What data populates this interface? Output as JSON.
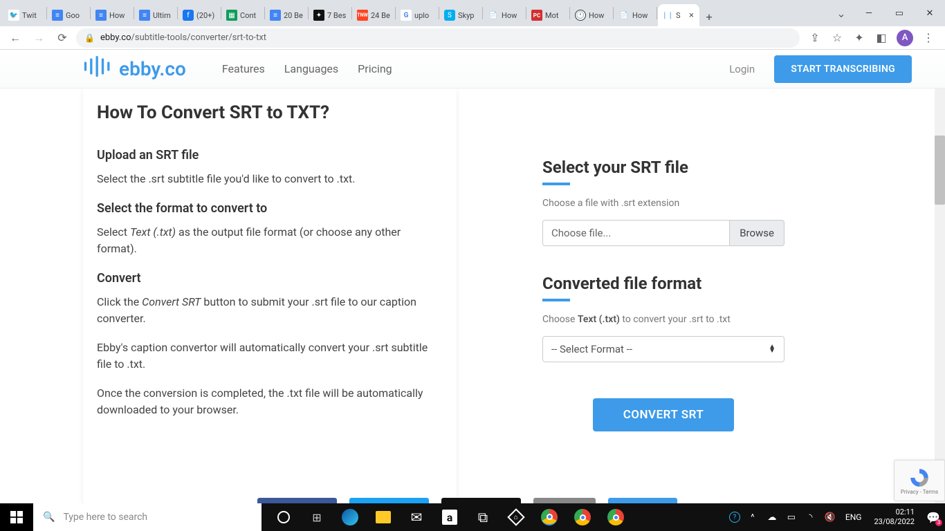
{
  "browser": {
    "tabs": [
      {
        "title": "Twit",
        "icon": "twitter",
        "cls": "fav-twitter",
        "glyph": "🐦"
      },
      {
        "title": "Goo",
        "icon": "gdocs",
        "cls": "fav-docs",
        "glyph": "≡"
      },
      {
        "title": "How",
        "icon": "gdocs",
        "cls": "fav-docs",
        "glyph": "≡"
      },
      {
        "title": "Ultim",
        "icon": "gdocs",
        "cls": "fav-docs",
        "glyph": "≡"
      },
      {
        "title": "(20+)",
        "icon": "facebook",
        "cls": "fav-fb",
        "glyph": "f"
      },
      {
        "title": "Cont",
        "icon": "gsheets",
        "cls": "fav-sheets",
        "glyph": "▦"
      },
      {
        "title": "20 Be",
        "icon": "gdocs",
        "cls": "fav-docs",
        "glyph": "≡"
      },
      {
        "title": "7 Bes",
        "icon": "black",
        "cls": "fav-black",
        "glyph": "✦"
      },
      {
        "title": "24 Be",
        "icon": "tnw",
        "cls": "fav-tnw",
        "glyph": "TNW"
      },
      {
        "title": "uplo",
        "icon": "google",
        "cls": "fav-google",
        "glyph": "G"
      },
      {
        "title": "Skyp",
        "icon": "skype",
        "cls": "fav-skype",
        "glyph": "S"
      },
      {
        "title": "How",
        "icon": "doc",
        "cls": "",
        "glyph": "📄"
      },
      {
        "title": "Mot",
        "icon": "pcmag",
        "cls": "fav-pc",
        "glyph": "PC"
      },
      {
        "title": "How",
        "icon": "clock",
        "cls": "fav-clock",
        "glyph": "🕐"
      },
      {
        "title": "How",
        "icon": "doc",
        "cls": "",
        "glyph": "📄"
      },
      {
        "title": "S",
        "icon": "ebby",
        "cls": "fav-ebby",
        "glyph": "❘❘",
        "active": true
      }
    ],
    "url_domain": "ebby.co",
    "url_path": "/subtitle-tools/converter/srt-to-txt",
    "avatar_letter": "A"
  },
  "header": {
    "logo_text": "ebby.co",
    "nav": [
      "Features",
      "Languages",
      "Pricing"
    ],
    "login": "Login",
    "cta": "START TRANSCRIBING"
  },
  "left": {
    "title": "How To Convert SRT to TXT?",
    "s1_h": "Upload an SRT file",
    "s1_p": "Select the .srt subtitle file you'd like to convert to .txt.",
    "s2_h": "Select the format to convert to",
    "s2_p_a": "Select ",
    "s2_p_em": "Text (.txt)",
    "s2_p_b": " as the output file format (or choose any other format).",
    "s3_h": "Convert",
    "s3_p1_a": "Click the ",
    "s3_p1_em": "Convert SRT",
    "s3_p1_b": " button to submit your .srt file to our caption converter.",
    "s3_p2": "Ebby's caption convertor will automatically convert your .srt subtitle file to .txt.",
    "s3_p3": "Once the conversion is completed, the .txt file will be automatically downloaded to your browser."
  },
  "right": {
    "h1": "Select your SRT file",
    "sub1": "Choose a file with .srt extension",
    "file_placeholder": "Choose file...",
    "browse": "Browse",
    "h2": "Converted file format",
    "sub2_a": "Choose ",
    "sub2_strong": "Text (.txt)",
    "sub2_b": " to convert your .srt to .txt",
    "select_placeholder": "-- Select Format --",
    "convert": "CONVERT SRT"
  },
  "recaptcha": {
    "l1": "Privacy",
    "l2": "Terms"
  },
  "taskbar": {
    "search_placeholder": "Type here to search",
    "lang": "ENG",
    "time": "02:11",
    "date": "23/08/2022"
  }
}
